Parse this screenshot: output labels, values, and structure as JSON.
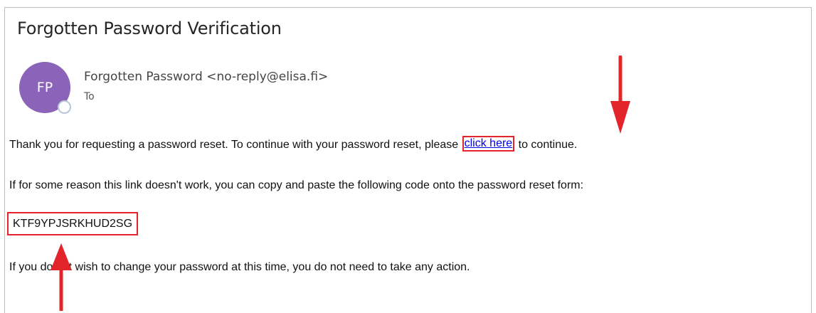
{
  "email": {
    "subject": "Forgotten Password Verification",
    "avatar_initials": "FP",
    "sender": "Forgotten Password <no-reply@elisa.fi>",
    "to_label": "To",
    "body": {
      "line1_before": "Thank you for requesting a password reset. To continue with your password reset, please",
      "link_text": "click here",
      "line1_after": "to continue.",
      "line2": "If for some reason this link doesn't work, you can copy and paste the following code onto the password reset form:",
      "reset_code": "KTF9YPJSRKHUD2SG",
      "line4": "If you do not wish to change your password at this time, you do not need to take any action."
    }
  },
  "annotations": {
    "highlight_color": "#e3242b"
  }
}
